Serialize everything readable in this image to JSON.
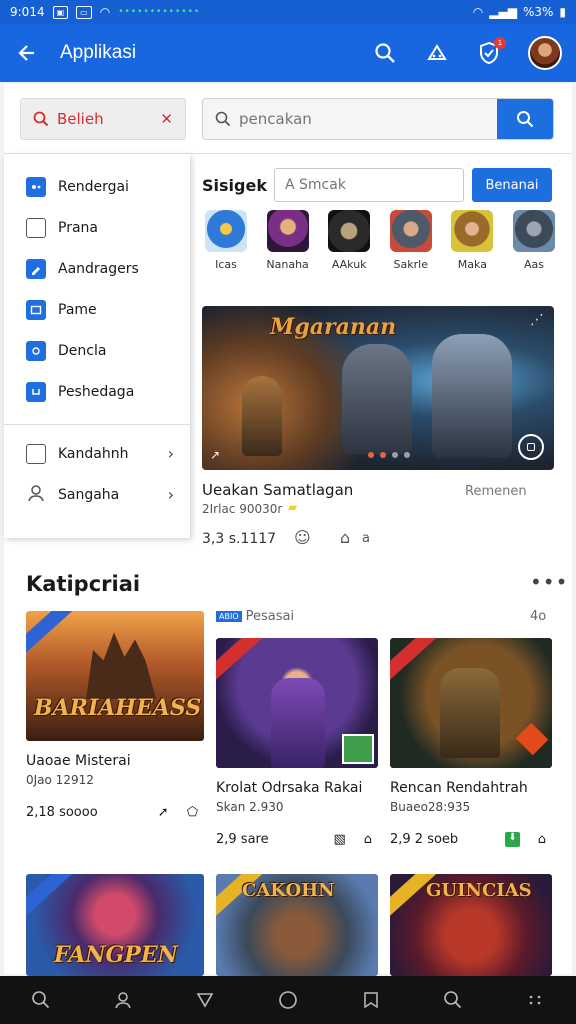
{
  "status": {
    "time": "9:014",
    "signal_text": "•••••••••••••",
    "battery": "%3%"
  },
  "appbar": {
    "title": "Applikasi",
    "notif_count": "1"
  },
  "topbar": {
    "chip_label": "Belieh",
    "search_placeholder": "pencakan"
  },
  "menu": {
    "items": [
      {
        "label": "Rendergai"
      },
      {
        "label": "Prana"
      },
      {
        "label": "Aandragers"
      },
      {
        "label": "Pame"
      },
      {
        "label": "Dencla"
      },
      {
        "label": "Peshedaga"
      }
    ],
    "footer": [
      {
        "label": "Kandahnh"
      },
      {
        "label": "Sangaha"
      }
    ]
  },
  "sort": {
    "label": "Sisigek",
    "placeholder": "A Smcak",
    "button": "Benanai"
  },
  "apps": [
    {
      "name": "Icas"
    },
    {
      "name": "Nanaha"
    },
    {
      "name": "AAkuk"
    },
    {
      "name": "Sakrle"
    },
    {
      "name": "Maka"
    },
    {
      "name": "Aas"
    }
  ],
  "banner": {
    "image_title": "Mgaranan",
    "title": "Ueakan Samatlagan",
    "subtitle": "2Irlac 90030r",
    "side_label": "Remenen",
    "stat": "3,3 s.1117",
    "count": "a"
  },
  "section": {
    "title": "Katipcriai",
    "tag_badge": "ABIO",
    "tag_label": "Pesasai",
    "tag_right": "4o"
  },
  "cards": [
    {
      "image_text": "BARIAHEASS",
      "title": "Uaoae Misterai",
      "sub": "0Jao 12912",
      "stat": "2,18 soooo"
    },
    {
      "image_text": "",
      "title": "Krolat Odrsaka Rakai",
      "sub": "Skan 2.930",
      "stat": "2,9 sare"
    },
    {
      "image_text": "",
      "title": "Rencan Rendahtrah",
      "sub": "Buaeo28:935",
      "stat": "2,9 2 soeb"
    },
    {
      "image_text": "FANGPEN",
      "title": "",
      "sub": "",
      "stat": ""
    },
    {
      "image_text": "CAKOHN",
      "title": "",
      "sub": "",
      "stat": ""
    },
    {
      "image_text": "GUINCIAS",
      "title": "",
      "sub": "",
      "stat": ""
    }
  ]
}
